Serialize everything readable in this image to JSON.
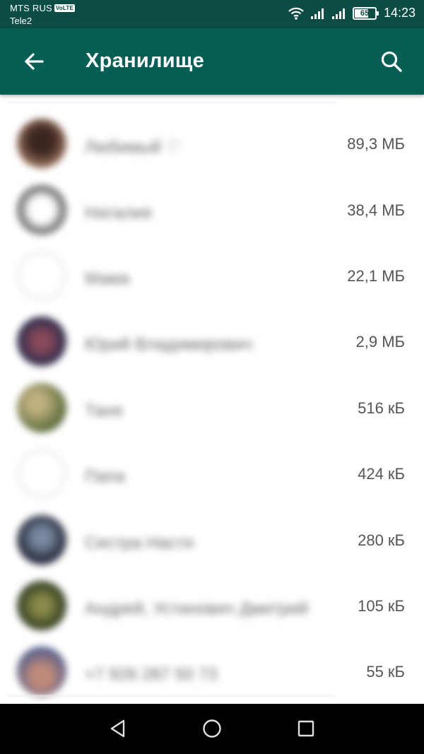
{
  "status_bar": {
    "carrier_primary": "MTS RUS",
    "volte_badge": "VoLTE",
    "carrier_secondary": "Tele2",
    "battery_level": "65",
    "time": "14:23",
    "icons": [
      "wifi-icon",
      "signal-icon",
      "signal-icon",
      "battery-icon"
    ]
  },
  "app_bar": {
    "title": "Хранилище",
    "back_icon": "arrow-left-icon",
    "search_icon": "search-icon",
    "colors": {
      "background": "#075e54",
      "status_bar": "#0b4d45"
    }
  },
  "chats": [
    {
      "name": "Любимый ♡",
      "size": "89,3 МБ",
      "avatar_color": "#5a3a2e"
    },
    {
      "name": "Наталия",
      "size": "38,4 МБ",
      "avatar_color": "#7d7d7d"
    },
    {
      "name": "Мама",
      "size": "22,1 МБ",
      "avatar_color": "blank"
    },
    {
      "name": "Юрий Владимирович",
      "size": "2,9 МБ",
      "avatar_color": "#5a4a6e"
    },
    {
      "name": "Таня",
      "size": "516 кБ",
      "avatar_color": "#8a8a5a"
    },
    {
      "name": "Папа",
      "size": "424 кБ",
      "avatar_color": "blank"
    },
    {
      "name": "Сестра Настя",
      "size": "280 кБ",
      "avatar_color": "#4a5062"
    },
    {
      "name": "Андрей, Устинович Дмитрий",
      "size": "105 кБ",
      "avatar_color": "#5e6a3a"
    },
    {
      "name": "+7 926 287 50 73",
      "size": "55 кБ",
      "avatar_color": "#8a6a6a"
    }
  ],
  "nav_bar": {
    "icons": [
      "back-triangle-icon",
      "home-circle-icon",
      "recents-square-icon"
    ]
  }
}
